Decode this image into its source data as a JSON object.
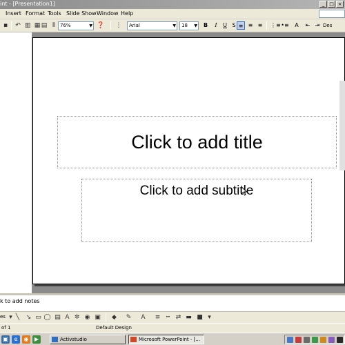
{
  "window": {
    "title": "int - [Presentation1]",
    "controls": {
      "minimize": "_",
      "maximize": "□",
      "close": "×"
    }
  },
  "menu": {
    "items": [
      "Insert",
      "Format",
      "Tools",
      "Slide Show",
      "Window",
      "Help"
    ]
  },
  "toolbar": {
    "zoom": "76%",
    "font": "Arial",
    "font_size": "18",
    "bold": "B",
    "italic": "I",
    "underline": "U",
    "design_label": "Des"
  },
  "slide": {
    "title_placeholder": "Click to add title",
    "subtitle_placeholder": "Click to add subtitle"
  },
  "notes": {
    "placeholder": "k to add notes"
  },
  "drawing_toolbar": {
    "draw_label": "es"
  },
  "status": {
    "slide_counter": "of 1",
    "design": "Default Design"
  },
  "taskbar": {
    "buttons": [
      "Activstudio",
      "Microsoft PowerPoint - [..."
    ],
    "active_index": 1
  },
  "colors": {
    "titlebar": "#9a9a9a",
    "chrome": "#ece9d8",
    "workarea": "#8b8b8b",
    "highlight": "#316ac5"
  }
}
